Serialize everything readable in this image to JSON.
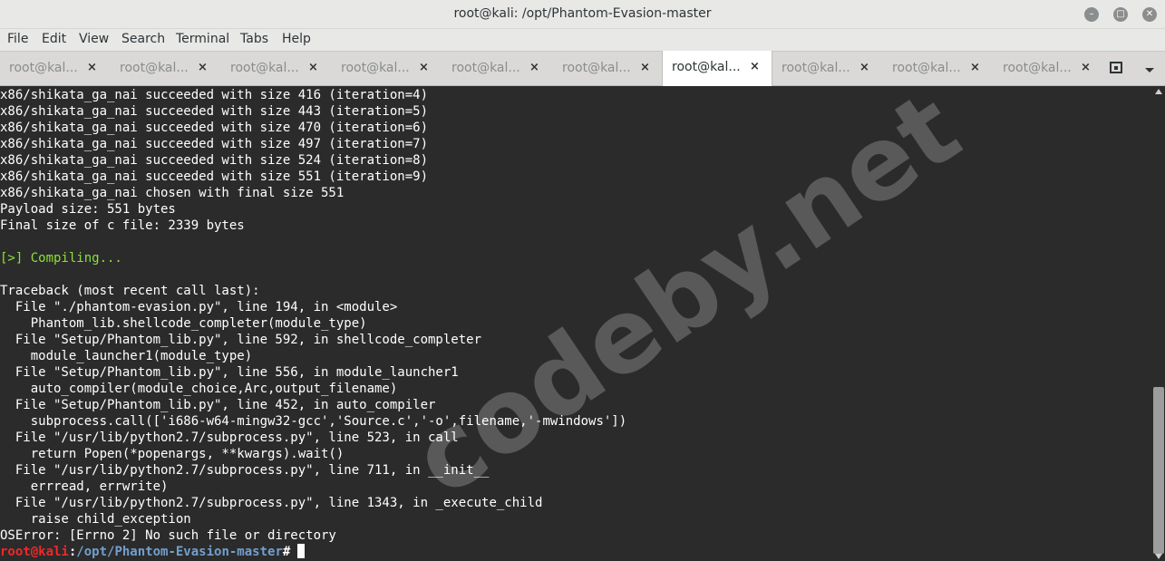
{
  "window": {
    "title": "root@kali: /opt/Phantom-Evasion-master"
  },
  "menu": [
    "File",
    "Edit",
    "View",
    "Search",
    "Terminal",
    "Tabs",
    "Help"
  ],
  "tabs": [
    {
      "label": "root@kal...",
      "active": false
    },
    {
      "label": "root@kal...",
      "active": false
    },
    {
      "label": "root@kal...",
      "active": false
    },
    {
      "label": "root@kal...",
      "active": false
    },
    {
      "label": "root@kal...",
      "active": false
    },
    {
      "label": "root@kal...",
      "active": false
    },
    {
      "label": "root@kal...",
      "active": true
    },
    {
      "label": "root@kal...",
      "active": false
    },
    {
      "label": "root@kal...",
      "active": false
    },
    {
      "label": "root@kal...",
      "active": false
    }
  ],
  "icons": {
    "close_tab": "×",
    "new_tab": "new-tab-icon",
    "tabs_menu": "chevron-down-icon"
  },
  "terminal": {
    "lines": [
      {
        "text": "x86/shikata_ga_nai succeeded with size 416 (iteration=4)"
      },
      {
        "text": "x86/shikata_ga_nai succeeded with size 443 (iteration=5)"
      },
      {
        "text": "x86/shikata_ga_nai succeeded with size 470 (iteration=6)"
      },
      {
        "text": "x86/shikata_ga_nai succeeded with size 497 (iteration=7)"
      },
      {
        "text": "x86/shikata_ga_nai succeeded with size 524 (iteration=8)"
      },
      {
        "text": "x86/shikata_ga_nai succeeded with size 551 (iteration=9)"
      },
      {
        "text": "x86/shikata_ga_nai chosen with final size 551"
      },
      {
        "text": "Payload size: 551 bytes"
      },
      {
        "text": "Final size of c file: 2339 bytes"
      },
      {
        "text": ""
      },
      {
        "text": "[>] Compiling...",
        "color": "green"
      },
      {
        "text": ""
      },
      {
        "text": "Traceback (most recent call last):"
      },
      {
        "text": "  File \"./phantom-evasion.py\", line 194, in <module>"
      },
      {
        "text": "    Phantom_lib.shellcode_completer(module_type)"
      },
      {
        "text": "  File \"Setup/Phantom_lib.py\", line 592, in shellcode_completer"
      },
      {
        "text": "    module_launcher1(module_type)"
      },
      {
        "text": "  File \"Setup/Phantom_lib.py\", line 556, in module_launcher1"
      },
      {
        "text": "    auto_compiler(module_choice,Arc,output_filename)"
      },
      {
        "text": "  File \"Setup/Phantom_lib.py\", line 452, in auto_compiler"
      },
      {
        "text": "    subprocess.call(['i686-w64-mingw32-gcc','Source.c','-o',filename,'-mwindows'])"
      },
      {
        "text": "  File \"/usr/lib/python2.7/subprocess.py\", line 523, in call"
      },
      {
        "text": "    return Popen(*popenargs, **kwargs).wait()"
      },
      {
        "text": "  File \"/usr/lib/python2.7/subprocess.py\", line 711, in __init__"
      },
      {
        "text": "    errread, errwrite)"
      },
      {
        "text": "  File \"/usr/lib/python2.7/subprocess.py\", line 1343, in _execute_child"
      },
      {
        "text": "    raise child_exception"
      },
      {
        "text": "OSError: [Errno 2] No such file or directory"
      }
    ],
    "prompt": {
      "user": "root@kali",
      "separator": ":",
      "path": "/opt/Phantom-Evasion-master",
      "symbol": "#"
    }
  },
  "watermark": "codeby.net",
  "colors": {
    "background": "#2b2b2b",
    "text": "#ffffff",
    "green": "#8ae234",
    "prompt_user": "#ef2929",
    "prompt_path": "#729fcf"
  }
}
